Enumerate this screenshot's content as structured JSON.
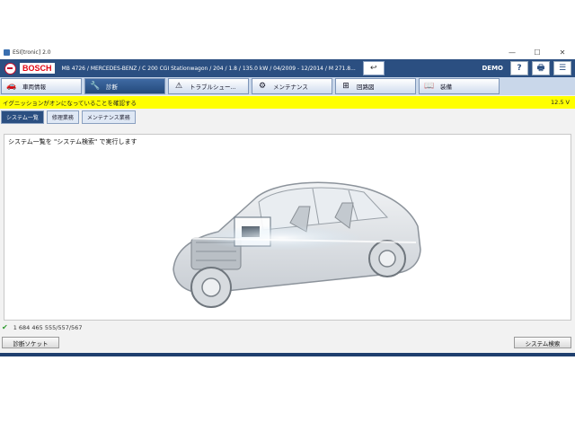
{
  "window": {
    "title": "ESI[tronic] 2.0",
    "controls": [
      "—",
      "☐",
      "✕"
    ]
  },
  "header": {
    "brand": "BOSCH",
    "vehicle": "MB 4726 / MERCEDES-BENZ / C 200 CGI Stationwagon / 204 / 1.8 / 135.0 kW / 04/2009 - 12/2014 / M 271.8...",
    "mode": "DEMO",
    "buttons": {
      "back": "↩",
      "help": "?",
      "print": "🖶",
      "menu": "☰"
    }
  },
  "tabs": [
    {
      "label": "車両情報",
      "icon": "🚗"
    },
    {
      "label": "診断",
      "icon": "🔧"
    },
    {
      "label": "トラブルシュー...",
      "icon": "⚠"
    },
    {
      "label": "メンテナンス",
      "icon": "⚙"
    },
    {
      "label": "回路図",
      "icon": "⊞"
    },
    {
      "label": "装備",
      "icon": "📖"
    }
  ],
  "alert": {
    "message": "イグニッションがオンになっていることを確認する",
    "voltage": "12.5 V"
  },
  "subtabs": [
    "システム一覧",
    "修理業務",
    "メンテナンス業務"
  ],
  "content": {
    "instruction": "システム一覧を \"システム検索\" で実行します"
  },
  "status": {
    "code": "1 684 465 555/557/567",
    "ok_icon": "✔"
  },
  "buttons": {
    "socket": "診断ソケット",
    "system_search": "システム検索"
  },
  "colors": {
    "header": "#2b4f81",
    "alert": "#ffff00",
    "brand": "#e30613"
  }
}
